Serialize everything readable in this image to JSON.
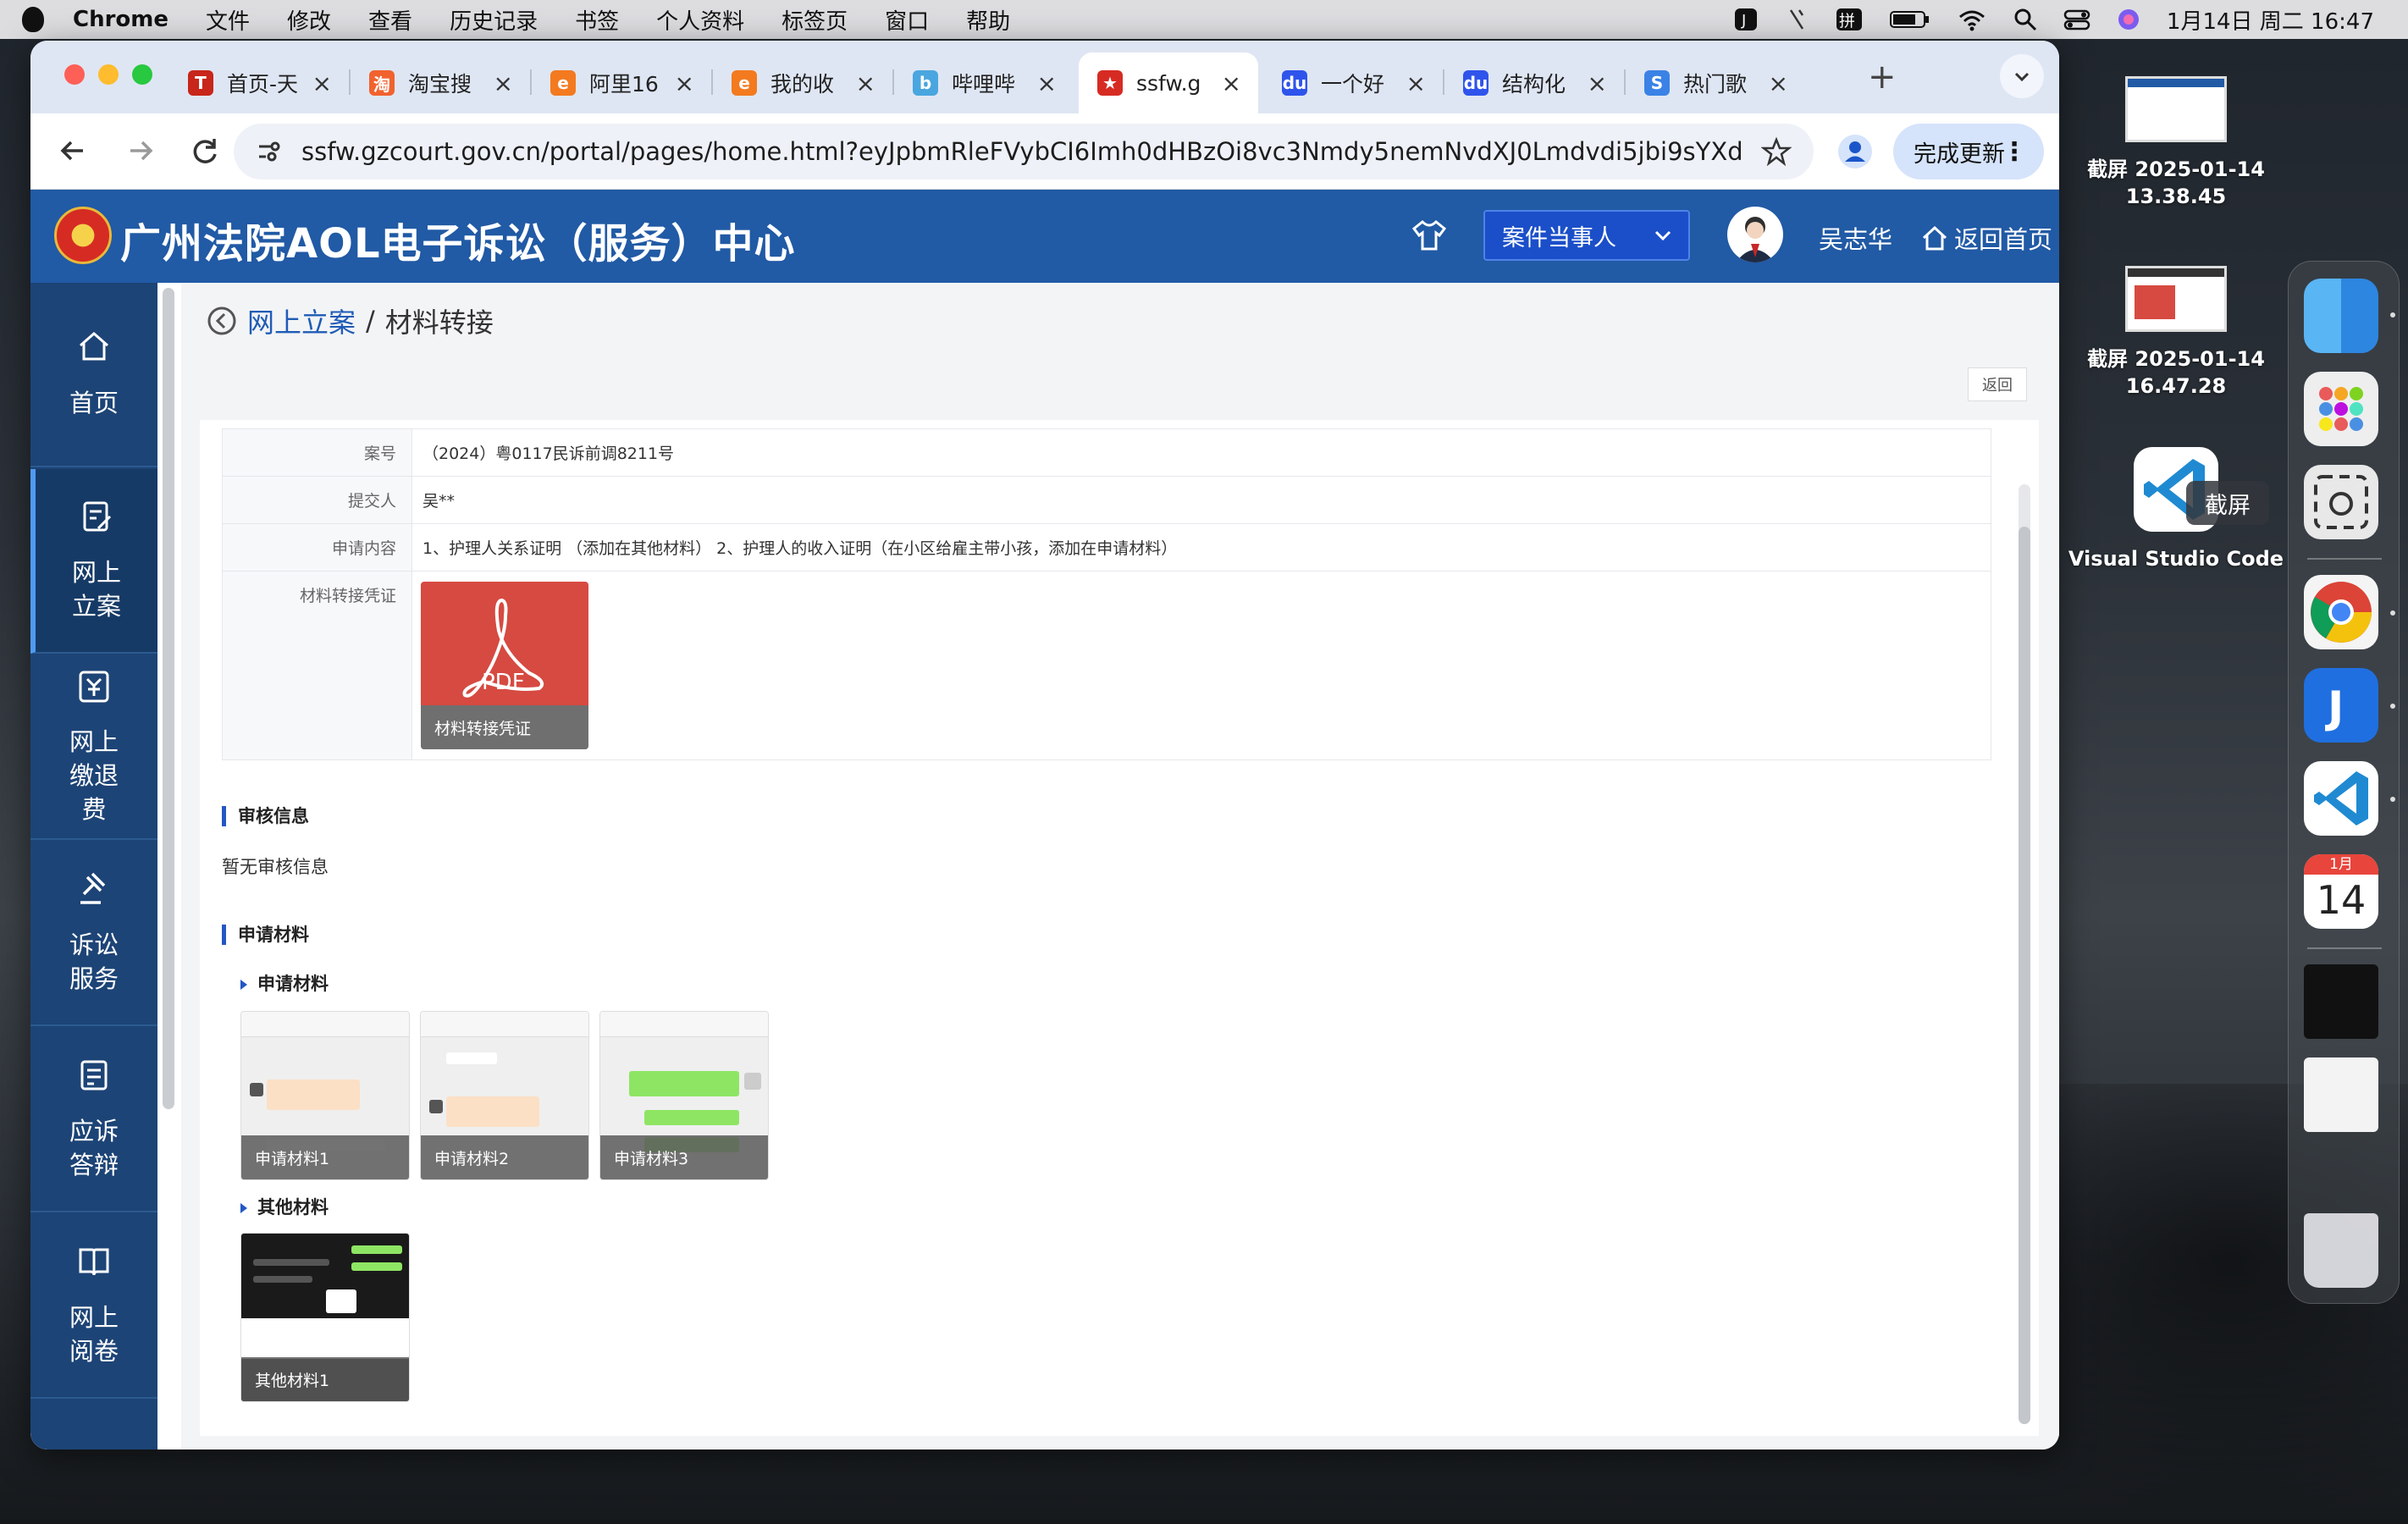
{
  "menubar": {
    "app": "Chrome",
    "items": [
      "文件",
      "修改",
      "查看",
      "历史记录",
      "书签",
      "个人资料",
      "标签页",
      "窗口",
      "帮助"
    ],
    "clock": "1月14日 周二  16:47"
  },
  "tabs": [
    {
      "title": "首页-天",
      "icon": "tianyancha-icon",
      "color": "#c8251b",
      "glyph": "T"
    },
    {
      "title": "淘宝搜",
      "icon": "taobao-icon",
      "color": "#f1622e",
      "glyph": "淘"
    },
    {
      "title": "阿里16",
      "icon": "alibaba-icon",
      "color": "#f47a1f",
      "glyph": "e"
    },
    {
      "title": "我的收",
      "icon": "alibaba-icon",
      "color": "#f47a1f",
      "glyph": "e"
    },
    {
      "title": "哔哩哔",
      "icon": "bilibili-icon",
      "color": "#4aa6df",
      "glyph": "b"
    },
    {
      "title": "ssfw.g",
      "icon": "emblem-icon",
      "color": "#d62b23",
      "glyph": "★"
    },
    {
      "title": "一个好",
      "icon": "baidu-icon",
      "color": "#2f54eb",
      "glyph": "du"
    },
    {
      "title": "结构化",
      "icon": "baidu-icon",
      "color": "#2f54eb",
      "glyph": "du"
    },
    {
      "title": "热门歌",
      "icon": "s-icon",
      "color": "#3b82e6",
      "glyph": "S"
    }
  ],
  "toolbar": {
    "url": "ssfw.gzcourt.gov.cn/portal/pages/home.html?eyJpbmRleFVybCI6Imh0dHBzOi8vc3Nmdy5nemNvdXJ0Lmdvdi5jbi9sYXdzdWl0L...",
    "update_label": "完成更新"
  },
  "header": {
    "title": "广州法院AOL电子诉讼（服务）中心",
    "role": "案件当事人",
    "user": "吴志华",
    "home": "返回首页"
  },
  "sidebar": [
    {
      "label": "首页",
      "icon": "home-icon"
    },
    {
      "label": "网上立案",
      "icon": "edit-doc-icon"
    },
    {
      "label": "网上缴退费",
      "icon": "payment-icon"
    },
    {
      "label": "诉讼服务",
      "icon": "gavel-icon"
    },
    {
      "label": "应诉答辩",
      "icon": "reply-doc-icon"
    },
    {
      "label": "网上阅卷",
      "icon": "book-icon"
    },
    {
      "label": "",
      "icon": "edit-doc-icon"
    }
  ],
  "breadcrumb": {
    "parent": "网上立案",
    "sep": "/",
    "current": "材料转接"
  },
  "back_small": "返回",
  "details": [
    {
      "label": "案号",
      "value": "（2024）粤0117民诉前调8211号"
    },
    {
      "label": "提交人",
      "value": "吴**"
    },
    {
      "label": "申请内容",
      "value": "1、护理人关系证明 （添加在其他材料） 2、护理人的收入证明（在小区给雇主带小孩，添加在申请材料）"
    },
    {
      "label": "材料转接凭证",
      "value": ""
    }
  ],
  "pdf": {
    "glyph": "PDF",
    "label": "材料转接凭证"
  },
  "review": {
    "title": "审核信息",
    "empty": "暂无审核信息"
  },
  "materials": {
    "title": "申请材料",
    "groups": [
      {
        "title": "申请材料",
        "items": [
          "申请材料1",
          "申请材料2",
          "申请材料3"
        ]
      },
      {
        "title": "其他材料",
        "items": [
          "其他材料1"
        ]
      }
    ]
  },
  "desktop": {
    "shots": [
      {
        "name": "截屏 2025-01-14",
        "time": "13.38.45"
      },
      {
        "name": "截屏 2025-01-14",
        "time": "16.47.28"
      }
    ],
    "vscode": "Visual Studio Code",
    "tooltip": "截屏",
    "calendar": {
      "month": "1月",
      "day": "14"
    }
  }
}
